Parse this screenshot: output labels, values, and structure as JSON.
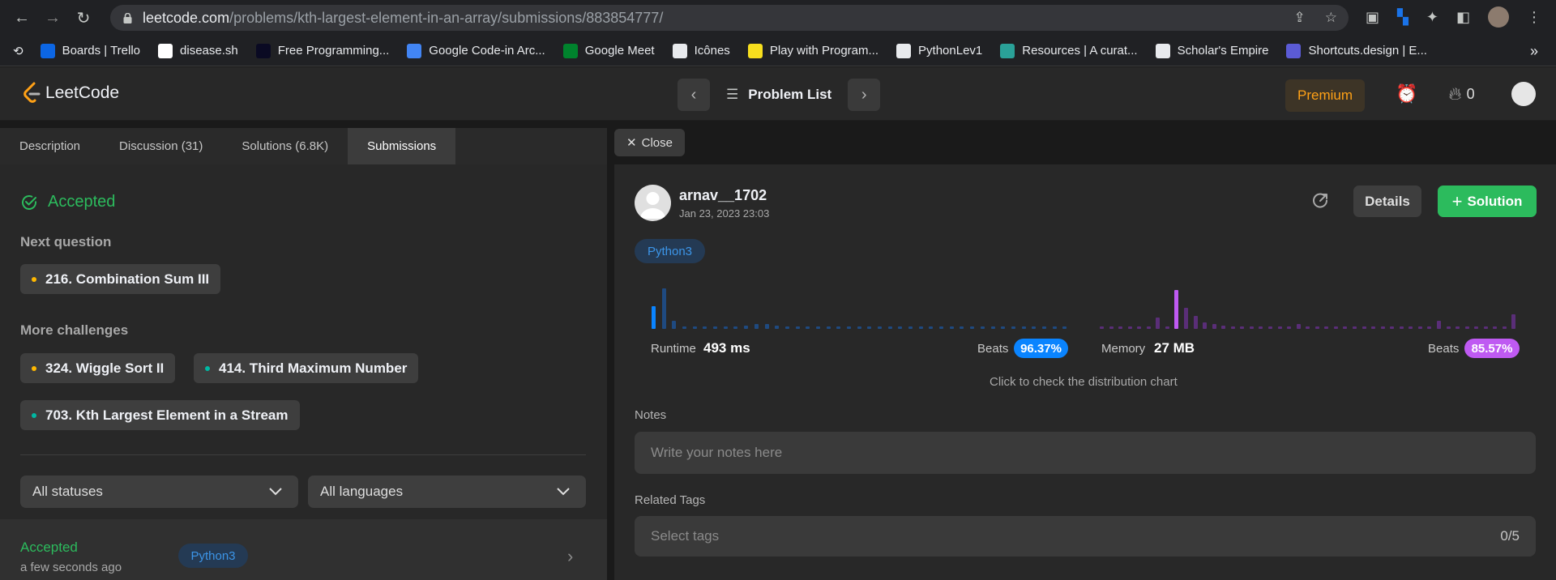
{
  "browser": {
    "url_host": "leetcode.com",
    "url_path": "/problems/kth-largest-element-in-an-array/submissions/883854777/",
    "bookmarks": [
      {
        "label": "Boards | Trello",
        "icon": "trello-icon",
        "color": "#0c66e4"
      },
      {
        "label": "disease.sh",
        "icon": "disease-icon",
        "color": "#ffffff"
      },
      {
        "label": "Free Programming...",
        "icon": "freecodecamp-icon",
        "color": "#0a0a23"
      },
      {
        "label": "Google Code-in Arc...",
        "icon": "gear-icon",
        "color": "#4285f4"
      },
      {
        "label": "Google Meet",
        "icon": "meet-icon",
        "color": "#00832d"
      },
      {
        "label": "Icônes",
        "icon": "icones-icon",
        "color": "#e8eaed"
      },
      {
        "label": "Play with Program...",
        "icon": "play-icon",
        "color": "#f7df1e"
      },
      {
        "label": "PythonLev1",
        "icon": "globe-icon",
        "color": "#e8eaed"
      },
      {
        "label": "Resources | A curat...",
        "icon": "resources-icon",
        "color": "#2aa198"
      },
      {
        "label": "Scholar's Empire",
        "icon": "globe-icon",
        "color": "#e8eaed"
      },
      {
        "label": "Shortcuts.design | E...",
        "icon": "shortcuts-icon",
        "color": "#5b5bd6"
      }
    ]
  },
  "nav": {
    "logo_text": "LeetCode",
    "problem_list": "Problem List",
    "premium": "Premium",
    "streak": "0"
  },
  "tabs": [
    {
      "label": "Description"
    },
    {
      "label": "Discussion (31)"
    },
    {
      "label": "Solutions (6.8K)"
    },
    {
      "label": "Submissions"
    }
  ],
  "close_label": "Close",
  "left": {
    "status": "Accepted",
    "next_question_label": "Next question",
    "next_question": {
      "label": "216. Combination Sum III",
      "dot": "#ffb800"
    },
    "more_challenges_label": "More challenges",
    "challenges": [
      {
        "label": "324. Wiggle Sort II",
        "dot": "#ffb800"
      },
      {
        "label": "414. Third Maximum Number",
        "dot": "#00b8a3"
      },
      {
        "label": "703. Kth Largest Element in a Stream",
        "dot": "#00b8a3"
      }
    ],
    "filter_status": "All statuses",
    "filter_language": "All languages",
    "submission": {
      "status": "Accepted",
      "time": "a few seconds ago",
      "language": "Python3"
    }
  },
  "right": {
    "username": "arnav__1702",
    "date": "Jan 23, 2023 23:03",
    "details": "Details",
    "solution": "Solution",
    "language": "Python3",
    "runtime_label": "Runtime",
    "runtime_value": "493 ms",
    "runtime_beats_label": "Beats",
    "runtime_beats": "96.37%",
    "memory_label": "Memory",
    "memory_value": "27 MB",
    "memory_beats_label": "Beats",
    "memory_beats": "85.57%",
    "hint": "Click to check the distribution chart",
    "notes_label": "Notes",
    "notes_placeholder": "Write your notes here",
    "tags_label": "Related Tags",
    "tags_placeholder": "Select tags",
    "tags_count": "0/5"
  },
  "colors": {
    "accent_green": "#2cbb5d",
    "runtime_blue": "#0a84ff",
    "memory_purple": "#bf5af2",
    "premium_orange": "#ffa116"
  }
}
